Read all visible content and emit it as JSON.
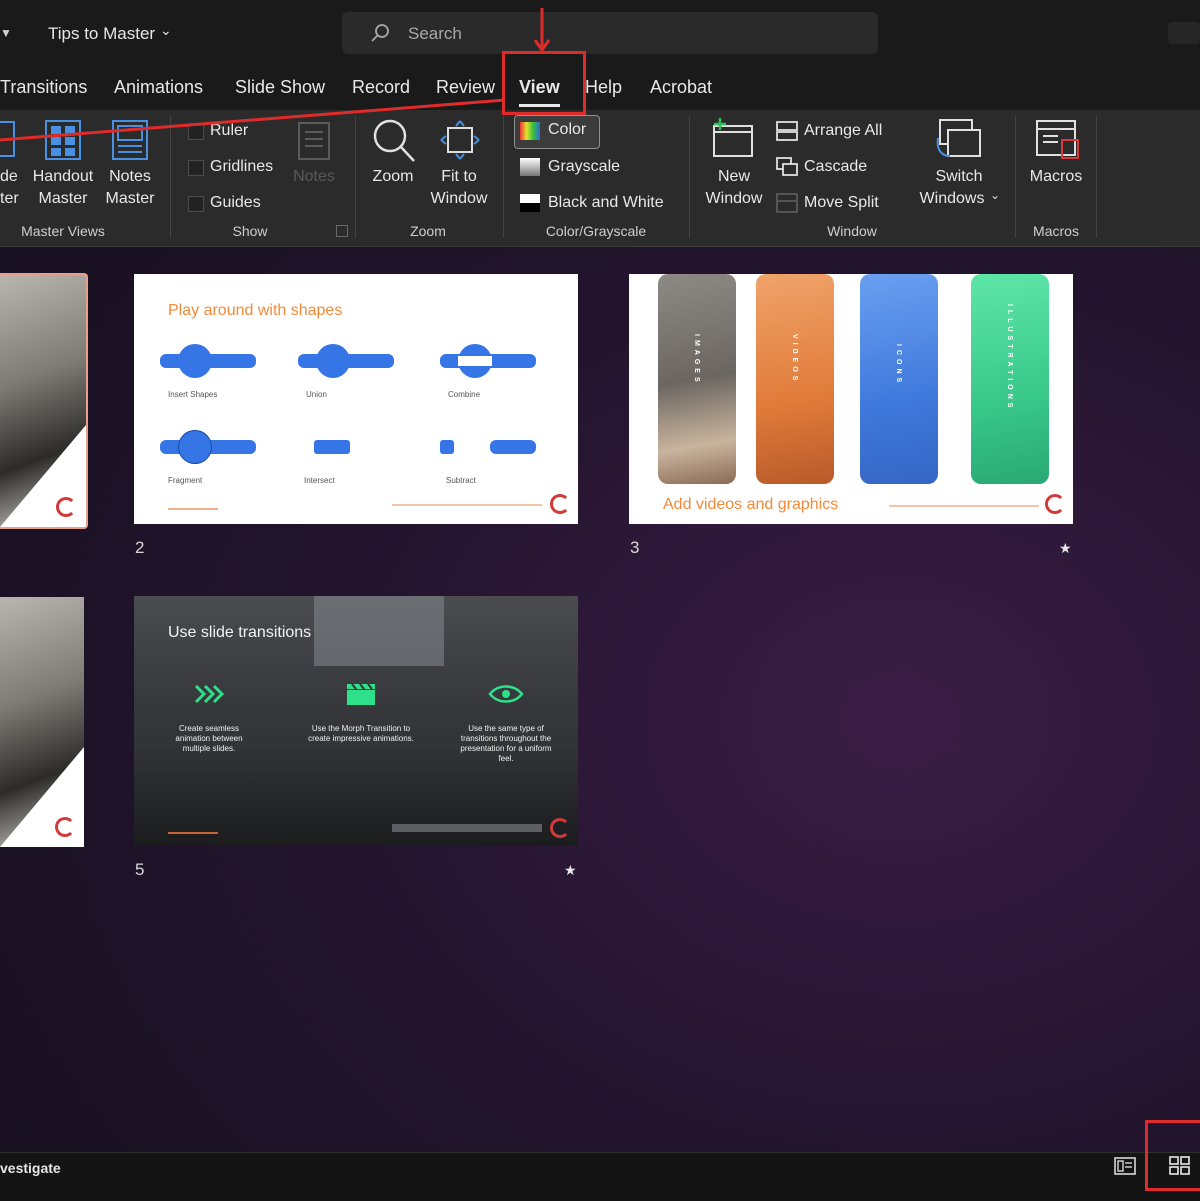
{
  "titlebar": {
    "doc_title": "Tips to Master",
    "search_placeholder": "Search"
  },
  "tabs": [
    "Transitions",
    "Animations",
    "Slide Show",
    "Record",
    "Review",
    "View",
    "Help",
    "Acrobat"
  ],
  "ribbon": {
    "master_views": {
      "partial_1a": "de",
      "partial_1b": "ter",
      "handout_1": "Handout",
      "handout_2": "Master",
      "notes_1": "Notes",
      "notes_2": "Master",
      "label": "Master Views"
    },
    "show": {
      "ruler": "Ruler",
      "gridlines": "Gridlines",
      "guides": "Guides",
      "notes": "Notes",
      "label": "Show"
    },
    "zoom": {
      "zoom": "Zoom",
      "fit_1": "Fit to",
      "fit_2": "Window",
      "label": "Zoom"
    },
    "color_grayscale": {
      "color": "Color",
      "grayscale": "Grayscale",
      "black_white": "Black and White",
      "label": "Color/Grayscale"
    },
    "window": {
      "new_1": "New",
      "new_2": "Window",
      "arrange_all": "Arrange All",
      "cascade": "Cascade",
      "move_split": "Move Split",
      "switch_1": "Switch",
      "switch_2": "Windows",
      "label": "Window"
    },
    "macros": {
      "macros": "Macros",
      "label": "Macros"
    }
  },
  "slides": {
    "slide2": {
      "number": "2",
      "title": "Play around with shapes",
      "captions": [
        "Insert Shapes",
        "Union",
        "Combine",
        "Fragment",
        "Intersect",
        "Subtract"
      ]
    },
    "slide3": {
      "number": "3",
      "title": "Add videos and graphics",
      "strips": [
        "IMAGES",
        "VIDEOS",
        "ICONS",
        "ILLUSTRATIONS"
      ]
    },
    "slide5": {
      "number": "5",
      "title": "Use slide transitions",
      "items": [
        "Create seamless animation between multiple slides.",
        "Use the Morph Transition to create impressive animations.",
        "Use the same type of transitions throughout the presentation for a uniform feel."
      ]
    }
  },
  "status": {
    "left_text": "vestigate"
  },
  "colors": {
    "accent_red": "#e02b2b",
    "orange": "#f28a3a",
    "shape_blue": "#3575e6",
    "icon_green": "#2fe08a"
  }
}
